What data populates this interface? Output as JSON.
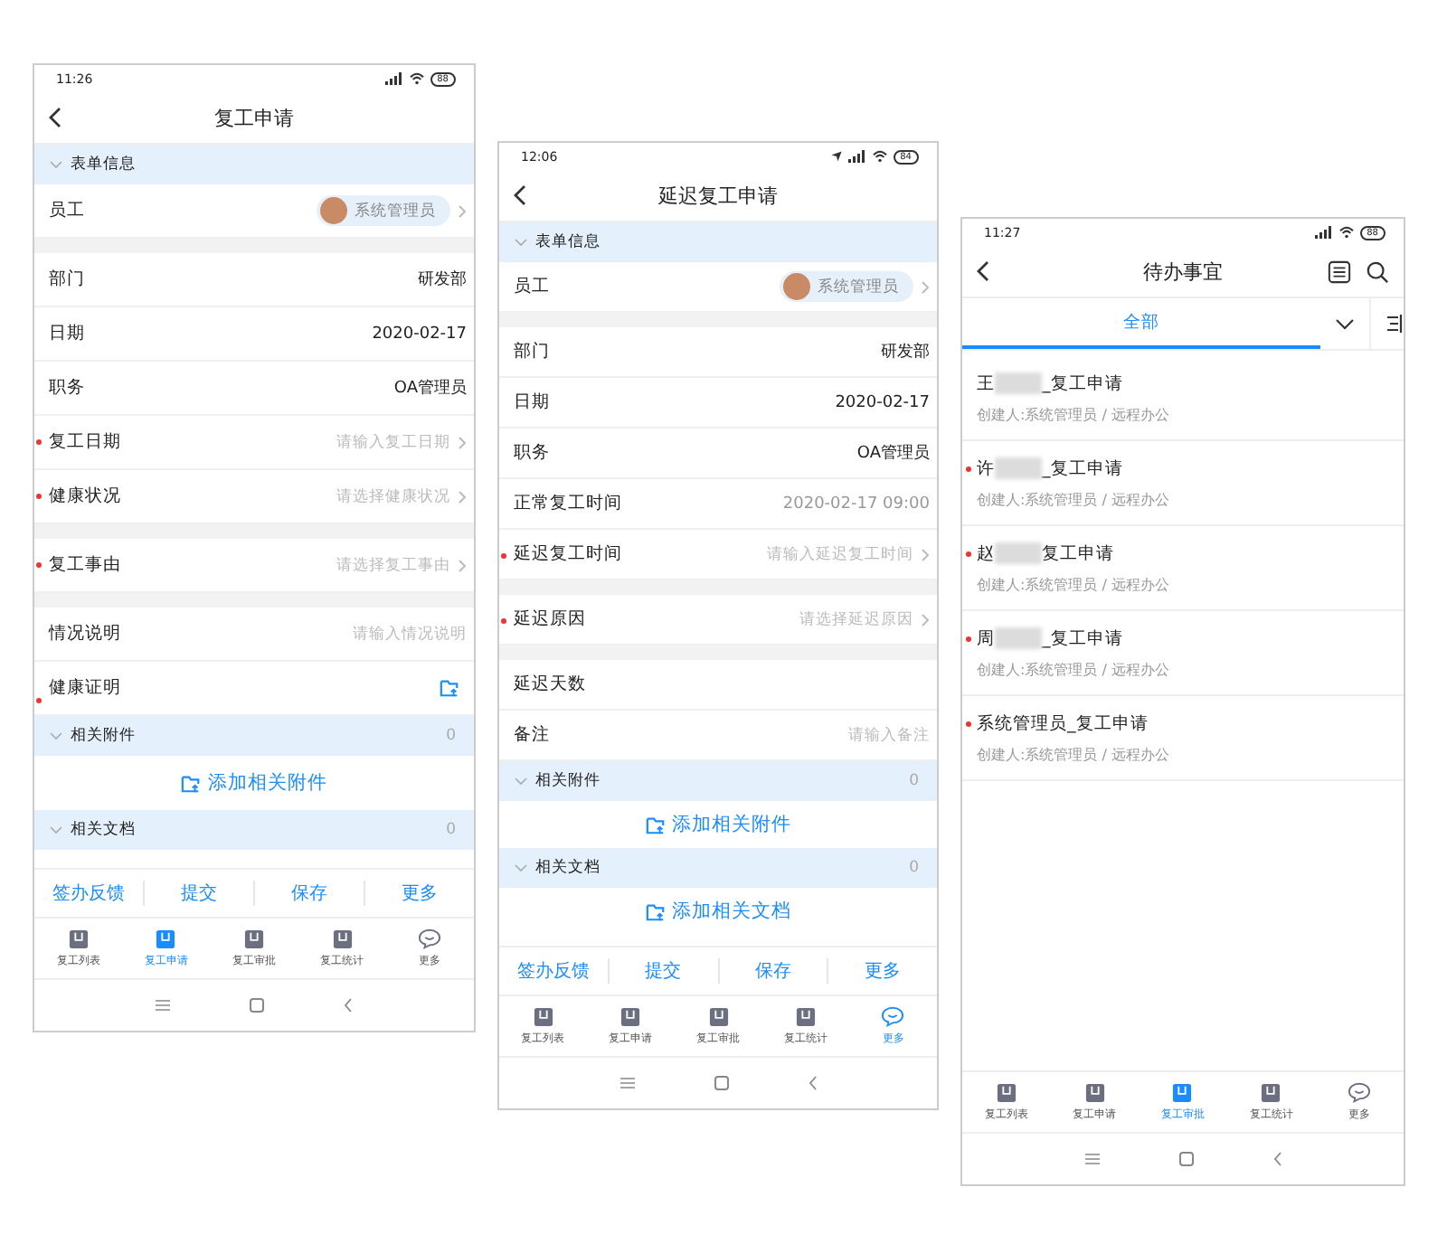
{
  "phones": [
    {
      "kind": "form",
      "status": {
        "time": "11:26",
        "battery": "88"
      },
      "title": "复工申请",
      "rows": [
        {
          "kind": "section",
          "title": "表单信息",
          "expanded": true
        },
        {
          "kind": "user",
          "label": "员工",
          "name": "系统管理员"
        },
        {
          "kind": "gap"
        },
        {
          "kind": "field",
          "label": "部门",
          "value": "研发部",
          "required": false,
          "arrow": false,
          "dim": false
        },
        {
          "kind": "field",
          "label": "日期",
          "value": "2020-02-17",
          "required": false,
          "arrow": false,
          "dim": false
        },
        {
          "kind": "field",
          "label": "职务",
          "value": "OA管理员",
          "required": false,
          "arrow": false,
          "dim": false
        },
        {
          "kind": "field",
          "label": "复工日期",
          "placeholder": "请输入复工日期",
          "required": true,
          "arrow": true
        },
        {
          "kind": "field",
          "label": "健康状况",
          "placeholder": "请选择健康状况",
          "required": true,
          "arrow": true
        },
        {
          "kind": "gap"
        },
        {
          "kind": "field",
          "label": "复工事由",
          "placeholder": "请选择复工事由",
          "required": true,
          "arrow": true
        },
        {
          "kind": "gap"
        },
        {
          "kind": "field",
          "label": "情况说明",
          "placeholder": "请输入情况说明",
          "required": false,
          "arrow": false
        },
        {
          "kind": "upload",
          "label": "健康证明",
          "required": true
        },
        {
          "kind": "section",
          "title": "相关附件",
          "count": "0",
          "expanded": true
        },
        {
          "kind": "add",
          "label": "添加相关附件"
        },
        {
          "kind": "section",
          "title": "相关文档",
          "count": "0",
          "expanded": true
        }
      ],
      "actions": [
        "签办反馈",
        "提交",
        "保存",
        "更多"
      ],
      "tabs": [
        {
          "label": "复工列表",
          "selected": false
        },
        {
          "label": "复工申请",
          "selected": true
        },
        {
          "label": "复工审批",
          "selected": false
        },
        {
          "label": "复工统计",
          "selected": false
        },
        {
          "label": "更多",
          "selected": false
        }
      ]
    },
    {
      "kind": "form",
      "status": {
        "time": "12:06",
        "battery": "84",
        "location": true
      },
      "title": "延迟复工申请",
      "rows": [
        {
          "kind": "section",
          "title": "表单信息",
          "expanded": true
        },
        {
          "kind": "user",
          "label": "员工",
          "name": "系统管理员"
        },
        {
          "kind": "gap"
        },
        {
          "kind": "field",
          "label": "部门",
          "value": "研发部",
          "required": false,
          "arrow": false,
          "dim": false
        },
        {
          "kind": "field",
          "label": "日期",
          "value": "2020-02-17",
          "required": false,
          "arrow": false,
          "dim": false
        },
        {
          "kind": "field",
          "label": "职务",
          "value": "OA管理员",
          "required": false,
          "arrow": false,
          "dim": false
        },
        {
          "kind": "field",
          "label": "正常复工时间",
          "value": "2020-02-17 09:00",
          "required": false,
          "arrow": false,
          "dim": true
        },
        {
          "kind": "field",
          "label": "延迟复工时间",
          "placeholder": "请输入延迟复工时间",
          "required": true,
          "arrow": true
        },
        {
          "kind": "gap"
        },
        {
          "kind": "field",
          "label": "延迟原因",
          "placeholder": "请选择延迟原因",
          "required": true,
          "arrow": true
        },
        {
          "kind": "gap"
        },
        {
          "kind": "field",
          "label": "延迟天数",
          "required": false,
          "arrow": false
        },
        {
          "kind": "field",
          "label": "备注",
          "placeholder": "请输入备注",
          "required": false,
          "arrow": false
        },
        {
          "kind": "section",
          "title": "相关附件",
          "count": "0",
          "expanded": true
        },
        {
          "kind": "add",
          "label": "添加相关附件"
        },
        {
          "kind": "section",
          "title": "相关文档",
          "count": "0",
          "expanded": true
        },
        {
          "kind": "add",
          "label": "添加相关文档"
        }
      ],
      "actions": [
        "签办反馈",
        "提交",
        "保存",
        "更多"
      ],
      "tabs": [
        {
          "label": "复工列表",
          "selected": false
        },
        {
          "label": "复工申请",
          "selected": false
        },
        {
          "label": "复工审批",
          "selected": false
        },
        {
          "label": "复工统计",
          "selected": false
        },
        {
          "label": "更多",
          "selected": true
        }
      ]
    },
    {
      "kind": "list",
      "status": {
        "time": "11:27",
        "battery": "88"
      },
      "title": "待办事宜",
      "filters": [
        {
          "label": "全部",
          "selected": true
        }
      ],
      "items": [
        {
          "parts": [
            "王",
            "_复工申请"
          ],
          "unread": false,
          "subtitle": "创建人:系统管理员 / 远程办公"
        },
        {
          "parts": [
            "许",
            "_复工申请"
          ],
          "unread": true,
          "subtitle": "创建人:系统管理员 / 远程办公"
        },
        {
          "parts": [
            "赵",
            "复工申请"
          ],
          "unread": true,
          "subtitle": "创建人:系统管理员 / 远程办公"
        },
        {
          "parts": [
            "周",
            "_复工申请"
          ],
          "unread": true,
          "subtitle": "创建人:系统管理员 / 远程办公"
        },
        {
          "parts": [
            "系统管理员_复工申请"
          ],
          "unread": true,
          "subtitle": "创建人:系统管理员 / 远程办公"
        }
      ],
      "tabs": [
        {
          "label": "复工列表",
          "selected": false
        },
        {
          "label": "复工申请",
          "selected": false
        },
        {
          "label": "复工审批",
          "selected": true
        },
        {
          "label": "复工统计",
          "selected": false
        },
        {
          "label": "更多",
          "selected": false
        }
      ]
    }
  ]
}
